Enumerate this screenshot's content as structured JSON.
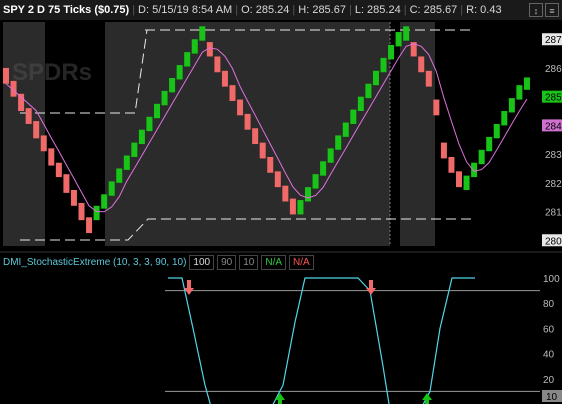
{
  "header": {
    "title": "SPY 2 D 75 Ticks ($0.75)",
    "date_label": "D: 5/15/19 8:54 AM",
    "open_label": "O: 285.24",
    "high_label": "H: 285.67",
    "low_label": "L: 285.24",
    "close_label": "C: 285.67",
    "range_label": "R: 0.43",
    "icons": [
      "expand-icon",
      "settings-icon"
    ]
  },
  "watermark": "SPDRs",
  "price_axis": {
    "ticks": [
      "287",
      "286",
      "285",
      "284",
      "283",
      "282",
      "281",
      "280"
    ],
    "highlight_green": "285",
    "highlight_magenta": "284",
    "highlight_white_top": "287",
    "highlight_white_bottom": "280"
  },
  "study": {
    "name": "DMI_StochasticExtreme (10, 3, 3, 90, 10)",
    "values": [
      "100",
      "90",
      "10",
      "N/A",
      "N/A"
    ],
    "axis_ticks": [
      "100",
      "80",
      "60",
      "40",
      "20"
    ],
    "axis_bottom_label": "10"
  },
  "colors": {
    "up": "#19c419",
    "down": "#f06a6a",
    "ma": "#e070e0",
    "stoch": "#4fd7e8",
    "background": "#000000",
    "shade": "#2b2b2b"
  },
  "chart_data": {
    "type": "bar",
    "candles": [
      [
        286.0,
        285.45,
        "down"
      ],
      [
        285.55,
        285.0,
        "down"
      ],
      [
        285.1,
        284.5,
        "down"
      ],
      [
        284.6,
        284.05,
        "down"
      ],
      [
        284.15,
        283.55,
        "down"
      ],
      [
        283.65,
        283.1,
        "down"
      ],
      [
        283.2,
        282.6,
        "down"
      ],
      [
        282.7,
        282.2,
        "down"
      ],
      [
        282.3,
        281.65,
        "down"
      ],
      [
        281.75,
        281.2,
        "down"
      ],
      [
        281.3,
        280.7,
        "down"
      ],
      [
        280.8,
        280.25,
        "down"
      ],
      [
        281.2,
        280.7,
        "up"
      ],
      [
        281.6,
        281.1,
        "up"
      ],
      [
        282.05,
        281.55,
        "up"
      ],
      [
        282.5,
        282.0,
        "up"
      ],
      [
        282.95,
        282.45,
        "up"
      ],
      [
        283.4,
        282.9,
        "up"
      ],
      [
        283.85,
        283.35,
        "up"
      ],
      [
        284.3,
        283.8,
        "up"
      ],
      [
        284.75,
        284.25,
        "up"
      ],
      [
        285.2,
        284.7,
        "up"
      ],
      [
        285.65,
        285.15,
        "up"
      ],
      [
        286.1,
        285.6,
        "up"
      ],
      [
        286.55,
        286.05,
        "up"
      ],
      [
        287.0,
        286.5,
        "up"
      ],
      [
        287.45,
        286.95,
        "up"
      ],
      [
        286.9,
        286.4,
        "down"
      ],
      [
        286.4,
        285.85,
        "down"
      ],
      [
        285.9,
        285.35,
        "down"
      ],
      [
        285.4,
        284.85,
        "down"
      ],
      [
        284.9,
        284.35,
        "down"
      ],
      [
        284.4,
        283.85,
        "down"
      ],
      [
        283.9,
        283.35,
        "down"
      ],
      [
        283.4,
        282.85,
        "down"
      ],
      [
        282.9,
        282.35,
        "down"
      ],
      [
        282.4,
        281.85,
        "down"
      ],
      [
        281.9,
        281.35,
        "down"
      ],
      [
        281.45,
        280.9,
        "down"
      ],
      [
        281.4,
        280.9,
        "up"
      ],
      [
        281.85,
        281.35,
        "up"
      ],
      [
        282.3,
        281.8,
        "up"
      ],
      [
        282.75,
        282.25,
        "up"
      ],
      [
        283.2,
        282.7,
        "up"
      ],
      [
        283.65,
        283.15,
        "up"
      ],
      [
        284.1,
        283.6,
        "up"
      ],
      [
        284.55,
        284.05,
        "up"
      ],
      [
        285.0,
        284.5,
        "up"
      ],
      [
        285.45,
        284.95,
        "up"
      ],
      [
        285.9,
        285.4,
        "up"
      ],
      [
        286.35,
        285.85,
        "up"
      ],
      [
        286.8,
        286.3,
        "up"
      ],
      [
        287.25,
        286.75,
        "up"
      ],
      [
        287.45,
        286.95,
        "up"
      ],
      [
        286.9,
        286.4,
        "down"
      ],
      [
        286.4,
        285.85,
        "down"
      ],
      [
        285.9,
        285.35,
        "down"
      ],
      [
        284.9,
        284.35,
        "down"
      ],
      [
        283.4,
        282.85,
        "down"
      ],
      [
        282.9,
        282.35,
        "down"
      ],
      [
        282.4,
        281.85,
        "down"
      ],
      [
        282.25,
        281.75,
        "up"
      ],
      [
        282.7,
        282.2,
        "up"
      ],
      [
        283.15,
        282.65,
        "up"
      ],
      [
        283.6,
        283.1,
        "up"
      ],
      [
        284.05,
        283.55,
        "up"
      ],
      [
        284.5,
        284.0,
        "up"
      ],
      [
        284.95,
        284.45,
        "up"
      ],
      [
        285.4,
        284.9,
        "up"
      ],
      [
        285.67,
        285.24,
        "up"
      ]
    ],
    "ylim": [
      279.8,
      287.6
    ]
  }
}
